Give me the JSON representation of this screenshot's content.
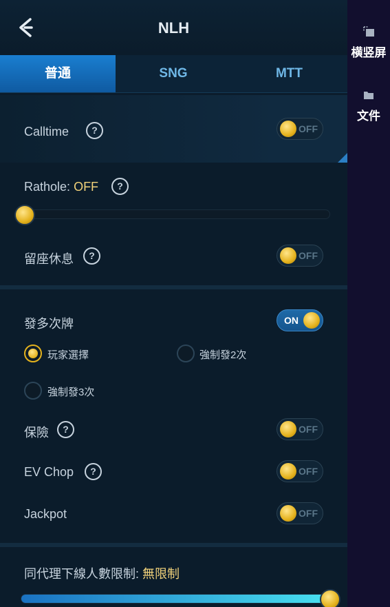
{
  "header": {
    "title": "NLH"
  },
  "tabs": [
    {
      "label": "普通",
      "active": true
    },
    {
      "label": "SNG",
      "active": false
    },
    {
      "label": "MTT",
      "active": false
    }
  ],
  "settings": {
    "calltime": {
      "label": "Calltime",
      "state": "OFF"
    },
    "rathole": {
      "label": "Rathole:",
      "value": "OFF",
      "slider_percent": 0
    },
    "sit_out": {
      "label": "留座休息",
      "state": "OFF"
    },
    "run_it_multiple": {
      "label": "發多次牌",
      "state": "ON",
      "options": [
        "玩家選擇",
        "強制發2次",
        "強制發3次"
      ],
      "selected": "玩家選擇"
    },
    "insurance": {
      "label": "保險",
      "state": "OFF"
    },
    "ev_chop": {
      "label": "EV Chop",
      "state": "OFF"
    },
    "jackpot": {
      "label": "Jackpot",
      "state": "OFF"
    },
    "agent_limit": {
      "label": "同代理下線人數限制:",
      "value": "無限制",
      "slider_percent": 100
    }
  },
  "right_sidebar": [
    {
      "label": "横竖屏",
      "icon": "rotate-screen-icon"
    },
    {
      "label": "文件",
      "icon": "folder-icon"
    }
  ],
  "colors": {
    "accent": "#1a7ed0",
    "highlight": "#f2d27a",
    "knob": "#e4b21d"
  }
}
